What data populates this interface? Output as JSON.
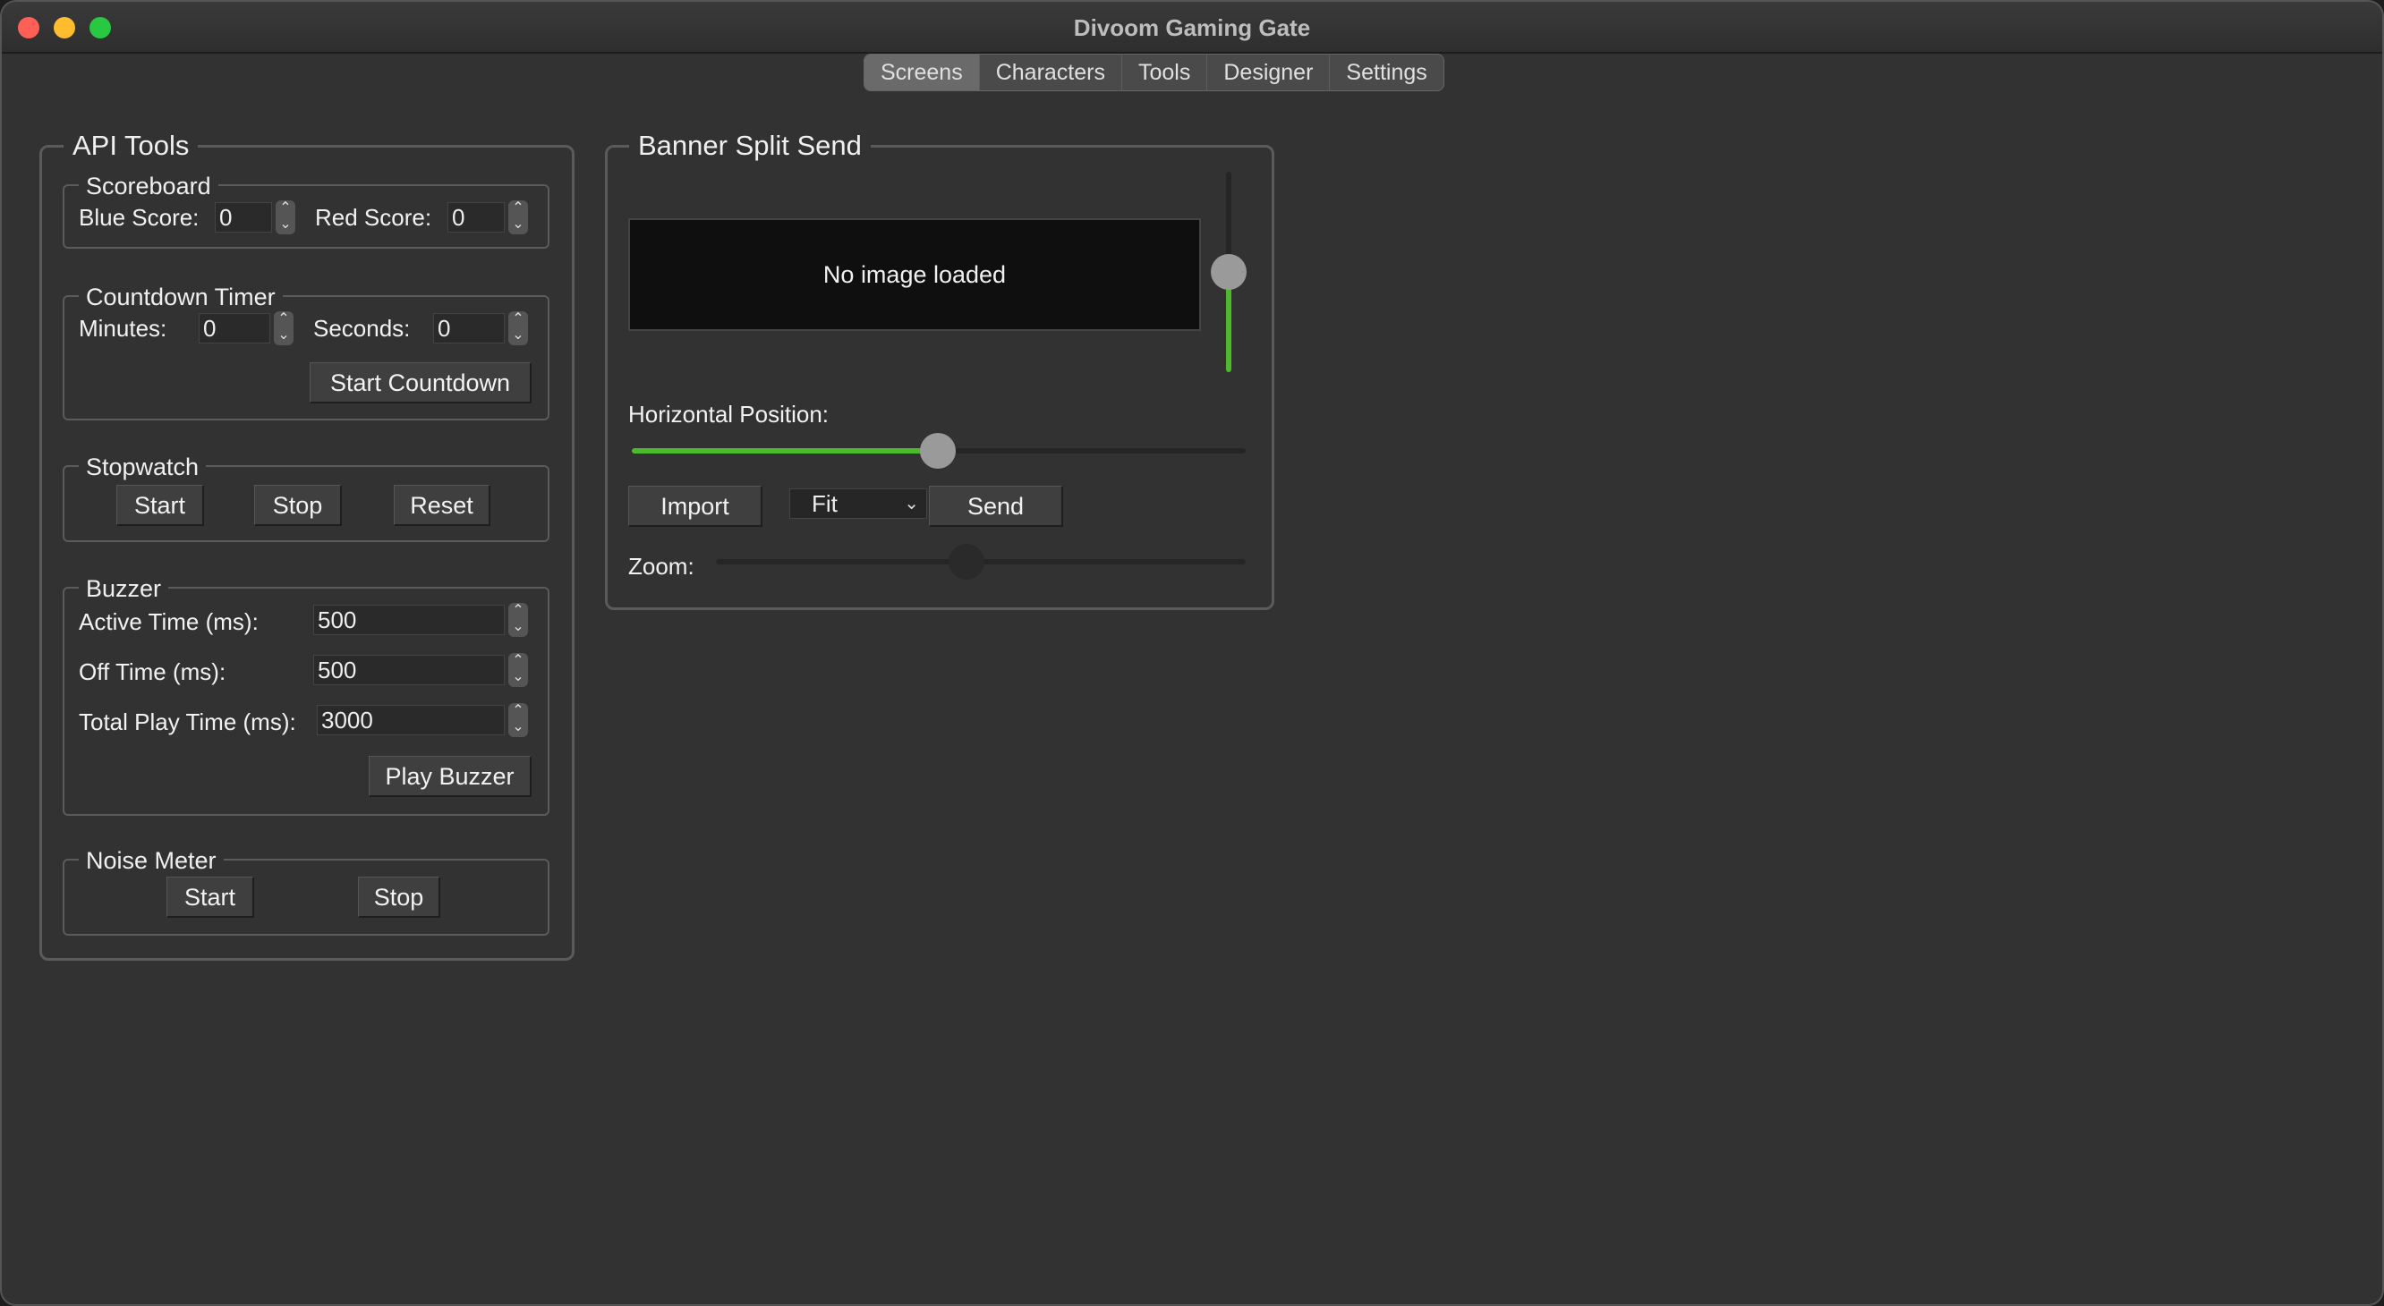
{
  "window": {
    "title": "Divoom Gaming Gate"
  },
  "tabs": [
    {
      "label": "Screens",
      "active": true
    },
    {
      "label": "Characters"
    },
    {
      "label": "Tools"
    },
    {
      "label": "Designer"
    },
    {
      "label": "Settings"
    }
  ],
  "api_tools": {
    "title": "API Tools",
    "scoreboard": {
      "title": "Scoreboard",
      "blue_label": "Blue Score:",
      "blue_value": "0",
      "red_label": "Red Score:",
      "red_value": "0"
    },
    "countdown": {
      "title": "Countdown Timer",
      "minutes_label": "Minutes:",
      "minutes_value": "0",
      "seconds_label": "Seconds:",
      "seconds_value": "0",
      "start_button": "Start Countdown"
    },
    "stopwatch": {
      "title": "Stopwatch",
      "start": "Start",
      "stop": "Stop",
      "reset": "Reset"
    },
    "buzzer": {
      "title": "Buzzer",
      "active_label": "Active Time (ms):",
      "active_value": "500",
      "off_label": "Off Time (ms):",
      "off_value": "500",
      "total_label": "Total Play Time (ms):",
      "total_value": "3000",
      "play_button": "Play Buzzer"
    },
    "noise_meter": {
      "title": "Noise Meter",
      "start": "Start",
      "stop": "Stop"
    }
  },
  "banner": {
    "title": "Banner Split  Send",
    "preview_text": "No image loaded",
    "vertical_slider_fraction": 0.5,
    "horizontal_label": "Horizontal Position:",
    "horizontal_fraction": 0.5,
    "import_button": "Import",
    "fit_select": "Fit",
    "send_button": "Send",
    "zoom_label": "Zoom:",
    "zoom_fraction": 0.47,
    "accent_color": "#4cbb2a"
  }
}
